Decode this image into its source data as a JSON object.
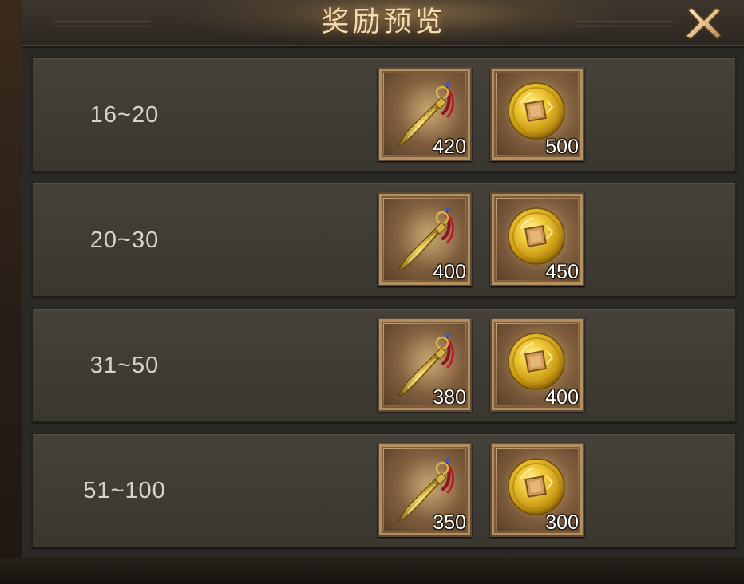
{
  "dialog": {
    "title": "奖励预览",
    "close_icon": "close-x-icon"
  },
  "colors": {
    "title_text": "#f3ddb4",
    "row_bg": "#423e38",
    "rank_text": "#d8d4cc",
    "qty_text": "#ffffff"
  },
  "reward_rows": [
    {
      "rank": "16~20",
      "rewards": [
        {
          "icon": "golden-dagger-icon",
          "quantity": "420"
        },
        {
          "icon": "gold-coin-icon",
          "quantity": "500"
        }
      ]
    },
    {
      "rank": "20~30",
      "rewards": [
        {
          "icon": "golden-dagger-icon",
          "quantity": "400"
        },
        {
          "icon": "gold-coin-icon",
          "quantity": "450"
        }
      ]
    },
    {
      "rank": "31~50",
      "rewards": [
        {
          "icon": "golden-dagger-icon",
          "quantity": "380"
        },
        {
          "icon": "gold-coin-icon",
          "quantity": "400"
        }
      ]
    },
    {
      "rank": "51~100",
      "rewards": [
        {
          "icon": "golden-dagger-icon",
          "quantity": "350"
        },
        {
          "icon": "gold-coin-icon",
          "quantity": "300"
        }
      ]
    }
  ]
}
